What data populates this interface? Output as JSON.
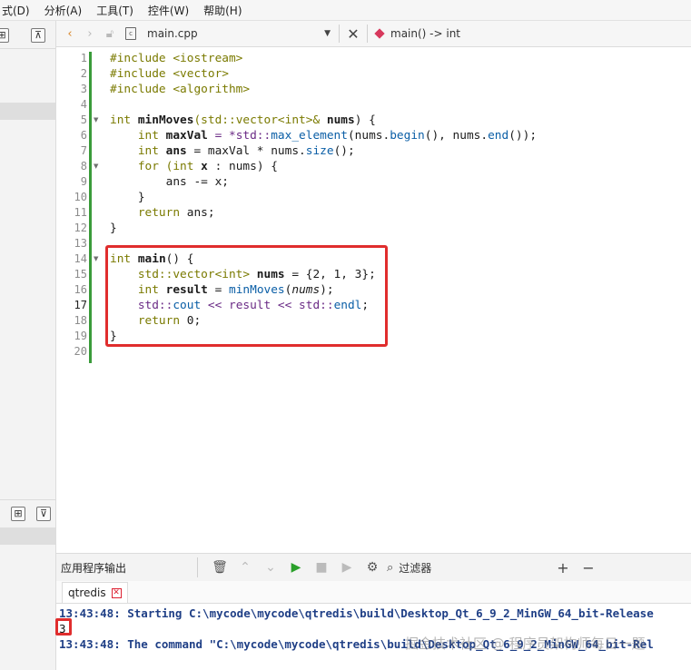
{
  "menubar": {
    "items": [
      "式(D)",
      "分析(A)",
      "工具(T)",
      "控件(W)",
      "帮助(H)"
    ]
  },
  "editor_toolbar": {
    "file_name": "main.cpp",
    "function_name": "main() -> int",
    "icons": [
      "back-arrow",
      "forward-arrow",
      "lock",
      "file",
      "close",
      "diamond"
    ]
  },
  "editor": {
    "current_line": 17,
    "lines": [
      {
        "n": "1",
        "fold": ""
      },
      {
        "n": "2",
        "fold": ""
      },
      {
        "n": "3",
        "fold": ""
      },
      {
        "n": "4",
        "fold": ""
      },
      {
        "n": "5",
        "fold": "▼"
      },
      {
        "n": "6",
        "fold": ""
      },
      {
        "n": "7",
        "fold": ""
      },
      {
        "n": "8",
        "fold": "▼"
      },
      {
        "n": "9",
        "fold": ""
      },
      {
        "n": "10",
        "fold": ""
      },
      {
        "n": "11",
        "fold": ""
      },
      {
        "n": "12",
        "fold": ""
      },
      {
        "n": "13",
        "fold": ""
      },
      {
        "n": "14",
        "fold": "▼"
      },
      {
        "n": "15",
        "fold": ""
      },
      {
        "n": "16",
        "fold": ""
      },
      {
        "n": "17",
        "fold": ""
      },
      {
        "n": "18",
        "fold": ""
      },
      {
        "n": "19",
        "fold": ""
      },
      {
        "n": "20",
        "fold": ""
      }
    ],
    "code": {
      "l1": "#include <iostream>",
      "l2": "#include <vector>",
      "l3": "#include <algorithm>",
      "l5a": "int ",
      "l5b": "minMoves",
      "l5c": "(std::vector<int>& ",
      "l5d": "nums",
      "l5e": ") {",
      "l6a": "    int ",
      "l6b": "maxVal",
      "l6c": " = *std::",
      "l6d": "max_element",
      "l6e": "(nums.",
      "l6f": "begin",
      "l6g": "(), nums.",
      "l6h": "end",
      "l6i": "());",
      "l7a": "    int ",
      "l7b": "ans",
      "l7c": " = maxVal * nums.",
      "l7d": "size",
      "l7e": "();",
      "l8a": "    for ",
      "l8b": "(int ",
      "l8c": "x",
      "l8d": " : nums) {",
      "l9": "        ans -= x;",
      "l10": "    }",
      "l11a": "    return ",
      "l11b": "ans;",
      "l12": "}",
      "l14a": "int ",
      "l14b": "main",
      "l14c": "() {",
      "l15a": "    std::vector<int> ",
      "l15b": "nums",
      "l15c": " = {2, 1, 3};",
      "l16a": "    int ",
      "l16b": "result",
      "l16c": " = ",
      "l16d": "minMoves",
      "l16e": "(",
      "l16f": "nums",
      "l16g": ");",
      "l17a": "    std::",
      "l17b": "cout",
      "l17c": " << result << std::",
      "l17d": "endl",
      "l17e": ";",
      "l18a": "    return ",
      "l18b": "0;",
      "l19": "}"
    }
  },
  "output": {
    "title": "应用程序输出",
    "filter_label": "过滤器",
    "tab_label": "qtredis",
    "lines": {
      "starting": "13:43:48: Starting C:\\mycode\\mycode\\qtredis\\build\\Desktop_Qt_6_9_2_MinGW_64_bit-Release",
      "result": "3",
      "finished": "13:43:48: The command \"C:\\mycode\\mycode\\qtredis\\build\\Desktop_Qt_6_9_2_MinGW_64_bit-Rel"
    }
  },
  "watermark": "掘金技术社区 @ 程序员架构师每日一题",
  "colors": {
    "highlight_box": "#e02d2d",
    "change_bar": "#3a9b3a",
    "run_button": "#2aa02a"
  }
}
